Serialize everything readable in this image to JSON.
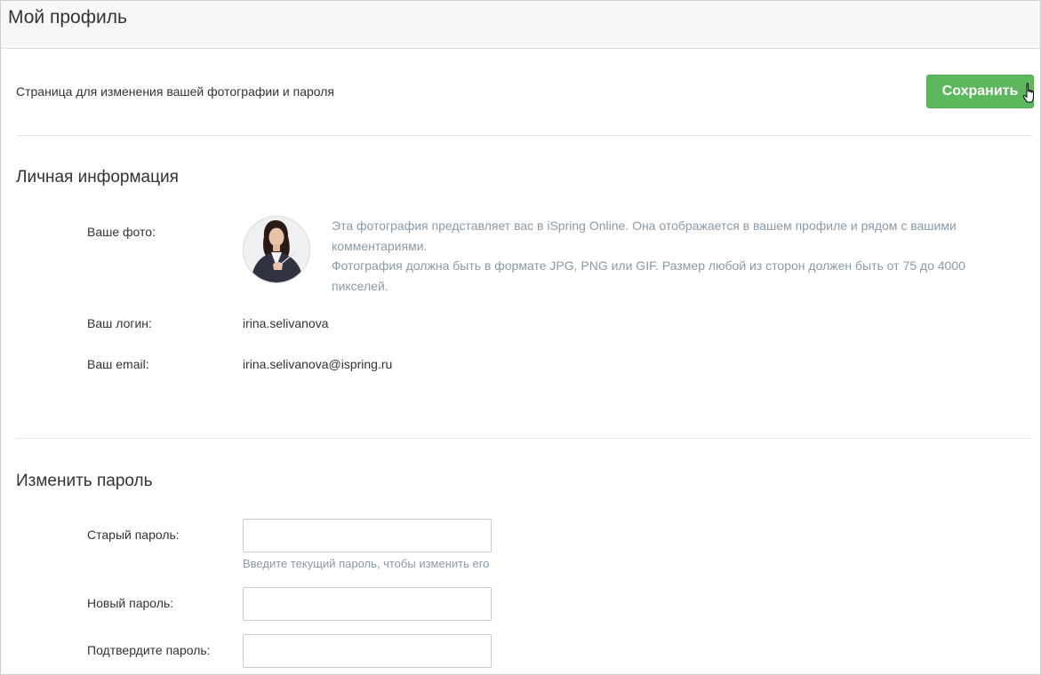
{
  "header": {
    "title": "Мой профиль"
  },
  "toolbar": {
    "subtitle": "Страница для изменения вашей фотографии и пароля",
    "save_label": "Сохранить"
  },
  "personal": {
    "section_title": "Личная информация",
    "photo_label": "Ваше фото:",
    "photo_hint_line1": "Эта фотография представляет вас в iSpring Online. Она отображается в вашем профиле и рядом с вашими комментариями.",
    "photo_hint_line2": "Фотография должна быть в формате JPG, PNG или GIF. Размер любой из сторон должен быть от 75 до 4000 пикселей.",
    "login_label": "Ваш логин:",
    "login_value": "irina.selivanova",
    "email_label": "Ваш email:",
    "email_value": "irina.selivanova@ispring.ru"
  },
  "password": {
    "section_title": "Изменить пароль",
    "old_label": "Старый пароль:",
    "old_value": "",
    "old_hint": "Введите текущий пароль, чтобы изменить его",
    "new_label": "Новый пароль:",
    "new_value": "",
    "confirm_label": "Подтвердите пароль:",
    "confirm_value": ""
  },
  "colors": {
    "accent": "#5cb85c",
    "hint_text": "#8a9aa6",
    "header_bg": "#f7f7f7"
  },
  "icons": {
    "cursor": "hand-pointer-icon"
  }
}
